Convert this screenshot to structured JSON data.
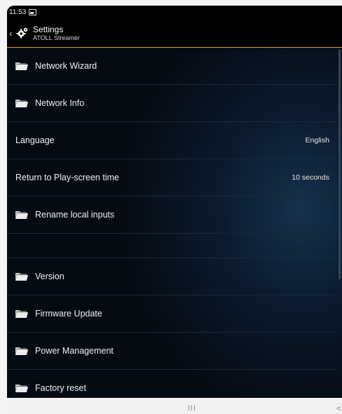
{
  "status": {
    "time": "11:53",
    "image_icon": "image-icon"
  },
  "appbar": {
    "title": "Settings",
    "subtitle": "ATOLL Streamer",
    "back_icon": "chevron-left-icon",
    "app_icon": "gears-icon"
  },
  "colors": {
    "accent": "#c9a227",
    "background": "#0b1b2d"
  },
  "items": [
    {
      "label": "Network Wizard",
      "icon": "folder-icon"
    },
    {
      "label": "Network Info",
      "icon": "folder-icon"
    },
    {
      "label": "Language",
      "value": "English"
    },
    {
      "label": "Return to Play-screen time",
      "value": "10 seconds"
    },
    {
      "label": "Rename local inputs",
      "icon": "folder-icon"
    },
    {
      "label": "Version",
      "icon": "folder-icon"
    },
    {
      "label": "Firmware Update",
      "icon": "folder-icon"
    },
    {
      "label": "Power Management",
      "icon": "folder-icon"
    },
    {
      "label": "Factory reset",
      "icon": "folder-icon"
    }
  ],
  "navbar": {
    "recent_glyph": "III",
    "back_glyph": "<"
  }
}
